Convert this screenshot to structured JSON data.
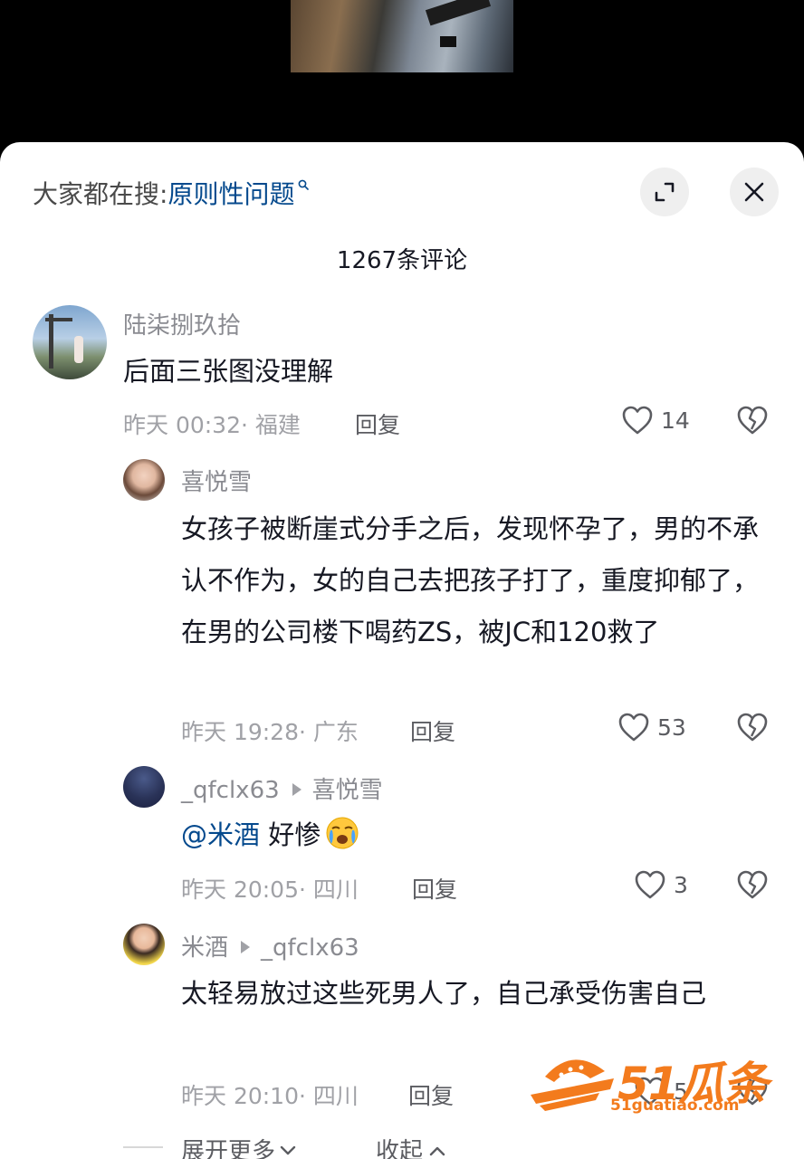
{
  "search": {
    "label": "大家都在搜:",
    "keyword": "原则性问题"
  },
  "comment_count": "1267条评论",
  "comments": [
    {
      "user": "陆柒捌玖拾",
      "text": "后面三张图没理解",
      "time": "昨天 00:32",
      "location": "福建",
      "reply": "回复",
      "likes": "14"
    },
    {
      "user": "喜悦雪",
      "text": "女孩子被断崖式分手之后，发现怀孕了，男的不承认不作为，女的自己去把孩子打了，重度抑郁了，在男的公司楼下喝药ZS，被JC和120救了",
      "time": "昨天 19:28",
      "location": "广东",
      "reply": "回复",
      "likes": "53"
    },
    {
      "user": "_qfclx63",
      "reply_to": "喜悦雪",
      "mention": "@米酒",
      "text": " 好惨",
      "time": "昨天 20:05",
      "location": "四川",
      "reply": "回复",
      "likes": "3"
    },
    {
      "user": "米酒",
      "reply_to": "_qfclx63",
      "text": "太轻易放过这些死男人了，自己承受伤害自己",
      "time": "昨天 20:10",
      "location": "四川",
      "reply": "回复",
      "likes": "5"
    }
  ],
  "footer": {
    "expand": "展开更多",
    "collapse": "收起"
  },
  "watermark": {
    "brand": "51瓜条",
    "url": "51guatiao.com"
  },
  "colors": {
    "link": "#04498d",
    "brand": "#f37b1d"
  }
}
